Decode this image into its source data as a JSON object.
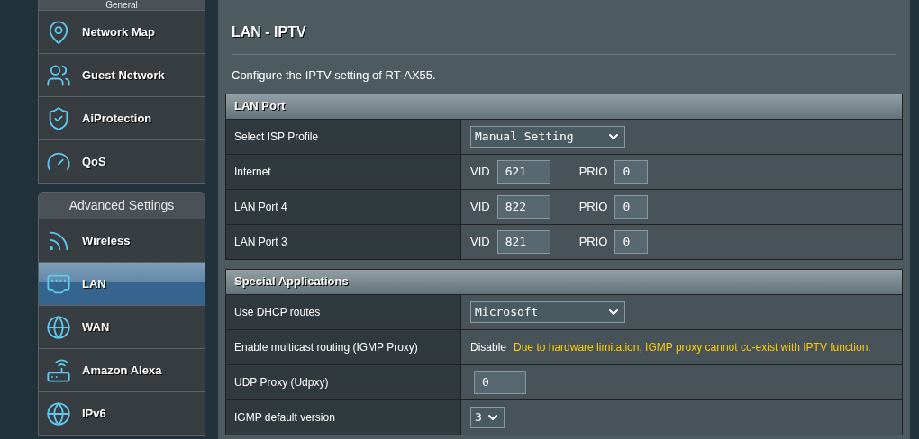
{
  "sidebar": {
    "general": {
      "title": "General",
      "items": [
        {
          "label": "Network Map",
          "selected": false
        },
        {
          "label": "Guest Network",
          "selected": false
        },
        {
          "label": "AiProtection",
          "selected": false
        },
        {
          "label": "QoS",
          "selected": false
        }
      ]
    },
    "advanced": {
      "title": "Advanced Settings",
      "items": [
        {
          "label": "Wireless",
          "selected": false
        },
        {
          "label": "LAN",
          "selected": true
        },
        {
          "label": "WAN",
          "selected": false
        },
        {
          "label": "Amazon Alexa",
          "selected": false
        },
        {
          "label": "IPv6",
          "selected": false
        }
      ]
    }
  },
  "page": {
    "title": "LAN - IPTV",
    "description": "Configure the IPTV setting of RT-AX55.",
    "sections": [
      {
        "title": "LAN Port",
        "rows": [
          {
            "kind": "select",
            "label": "Select ISP Profile",
            "value": "Manual Setting"
          },
          {
            "kind": "vlan",
            "label": "Internet",
            "vid_label": "VID",
            "vid": "621",
            "prio_label": "PRIO",
            "prio": "0"
          },
          {
            "kind": "vlan",
            "label": "LAN Port 4",
            "vid_label": "VID",
            "vid": "822",
            "prio_label": "PRIO",
            "prio": "0"
          },
          {
            "kind": "vlan",
            "label": "LAN Port 3",
            "vid_label": "VID",
            "vid": "821",
            "prio_label": "PRIO",
            "prio": "0"
          }
        ]
      },
      {
        "title": "Special Applications",
        "rows": [
          {
            "kind": "select",
            "label": "Use DHCP routes",
            "value": "Microsoft"
          },
          {
            "kind": "note",
            "label": "Enable multicast routing (IGMP Proxy)",
            "value": "Disable",
            "warning": "Due to hardware limitation, IGMP proxy cannot co-exist with IPTV function."
          },
          {
            "kind": "input",
            "label": "UDP Proxy (Udpxy)",
            "value": "0"
          },
          {
            "kind": "small_select",
            "label": "IGMP default version",
            "value": "3"
          }
        ]
      }
    ]
  }
}
